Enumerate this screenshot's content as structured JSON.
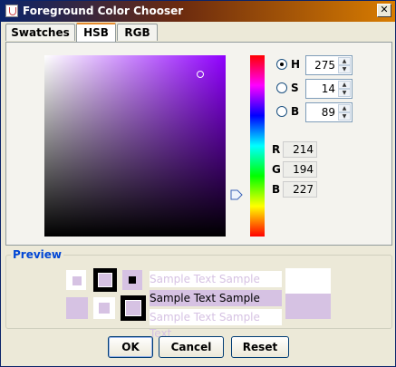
{
  "window": {
    "title": "Foreground Color Chooser",
    "close_glyph": "✕"
  },
  "tabs": [
    {
      "label": "Swatches",
      "active": false
    },
    {
      "label": "HSB",
      "active": true
    },
    {
      "label": "RGB",
      "active": false
    }
  ],
  "hsb": {
    "h": {
      "label": "H",
      "value": "275",
      "checked": true
    },
    "s": {
      "label": "S",
      "value": "14",
      "checked": false
    },
    "b": {
      "label": "B",
      "value": "89",
      "checked": false
    }
  },
  "rgb": {
    "r": {
      "label": "R",
      "value": "214"
    },
    "g": {
      "label": "G",
      "value": "194"
    },
    "b": {
      "label": "B",
      "value": "227"
    }
  },
  "colors": {
    "selected": "#d6c2e3",
    "hue_pure": "#9000ff"
  },
  "preview": {
    "title": "Preview",
    "sample_text": "Sample Text"
  },
  "buttons": {
    "ok": "OK",
    "cancel": "Cancel",
    "reset": "Reset"
  }
}
